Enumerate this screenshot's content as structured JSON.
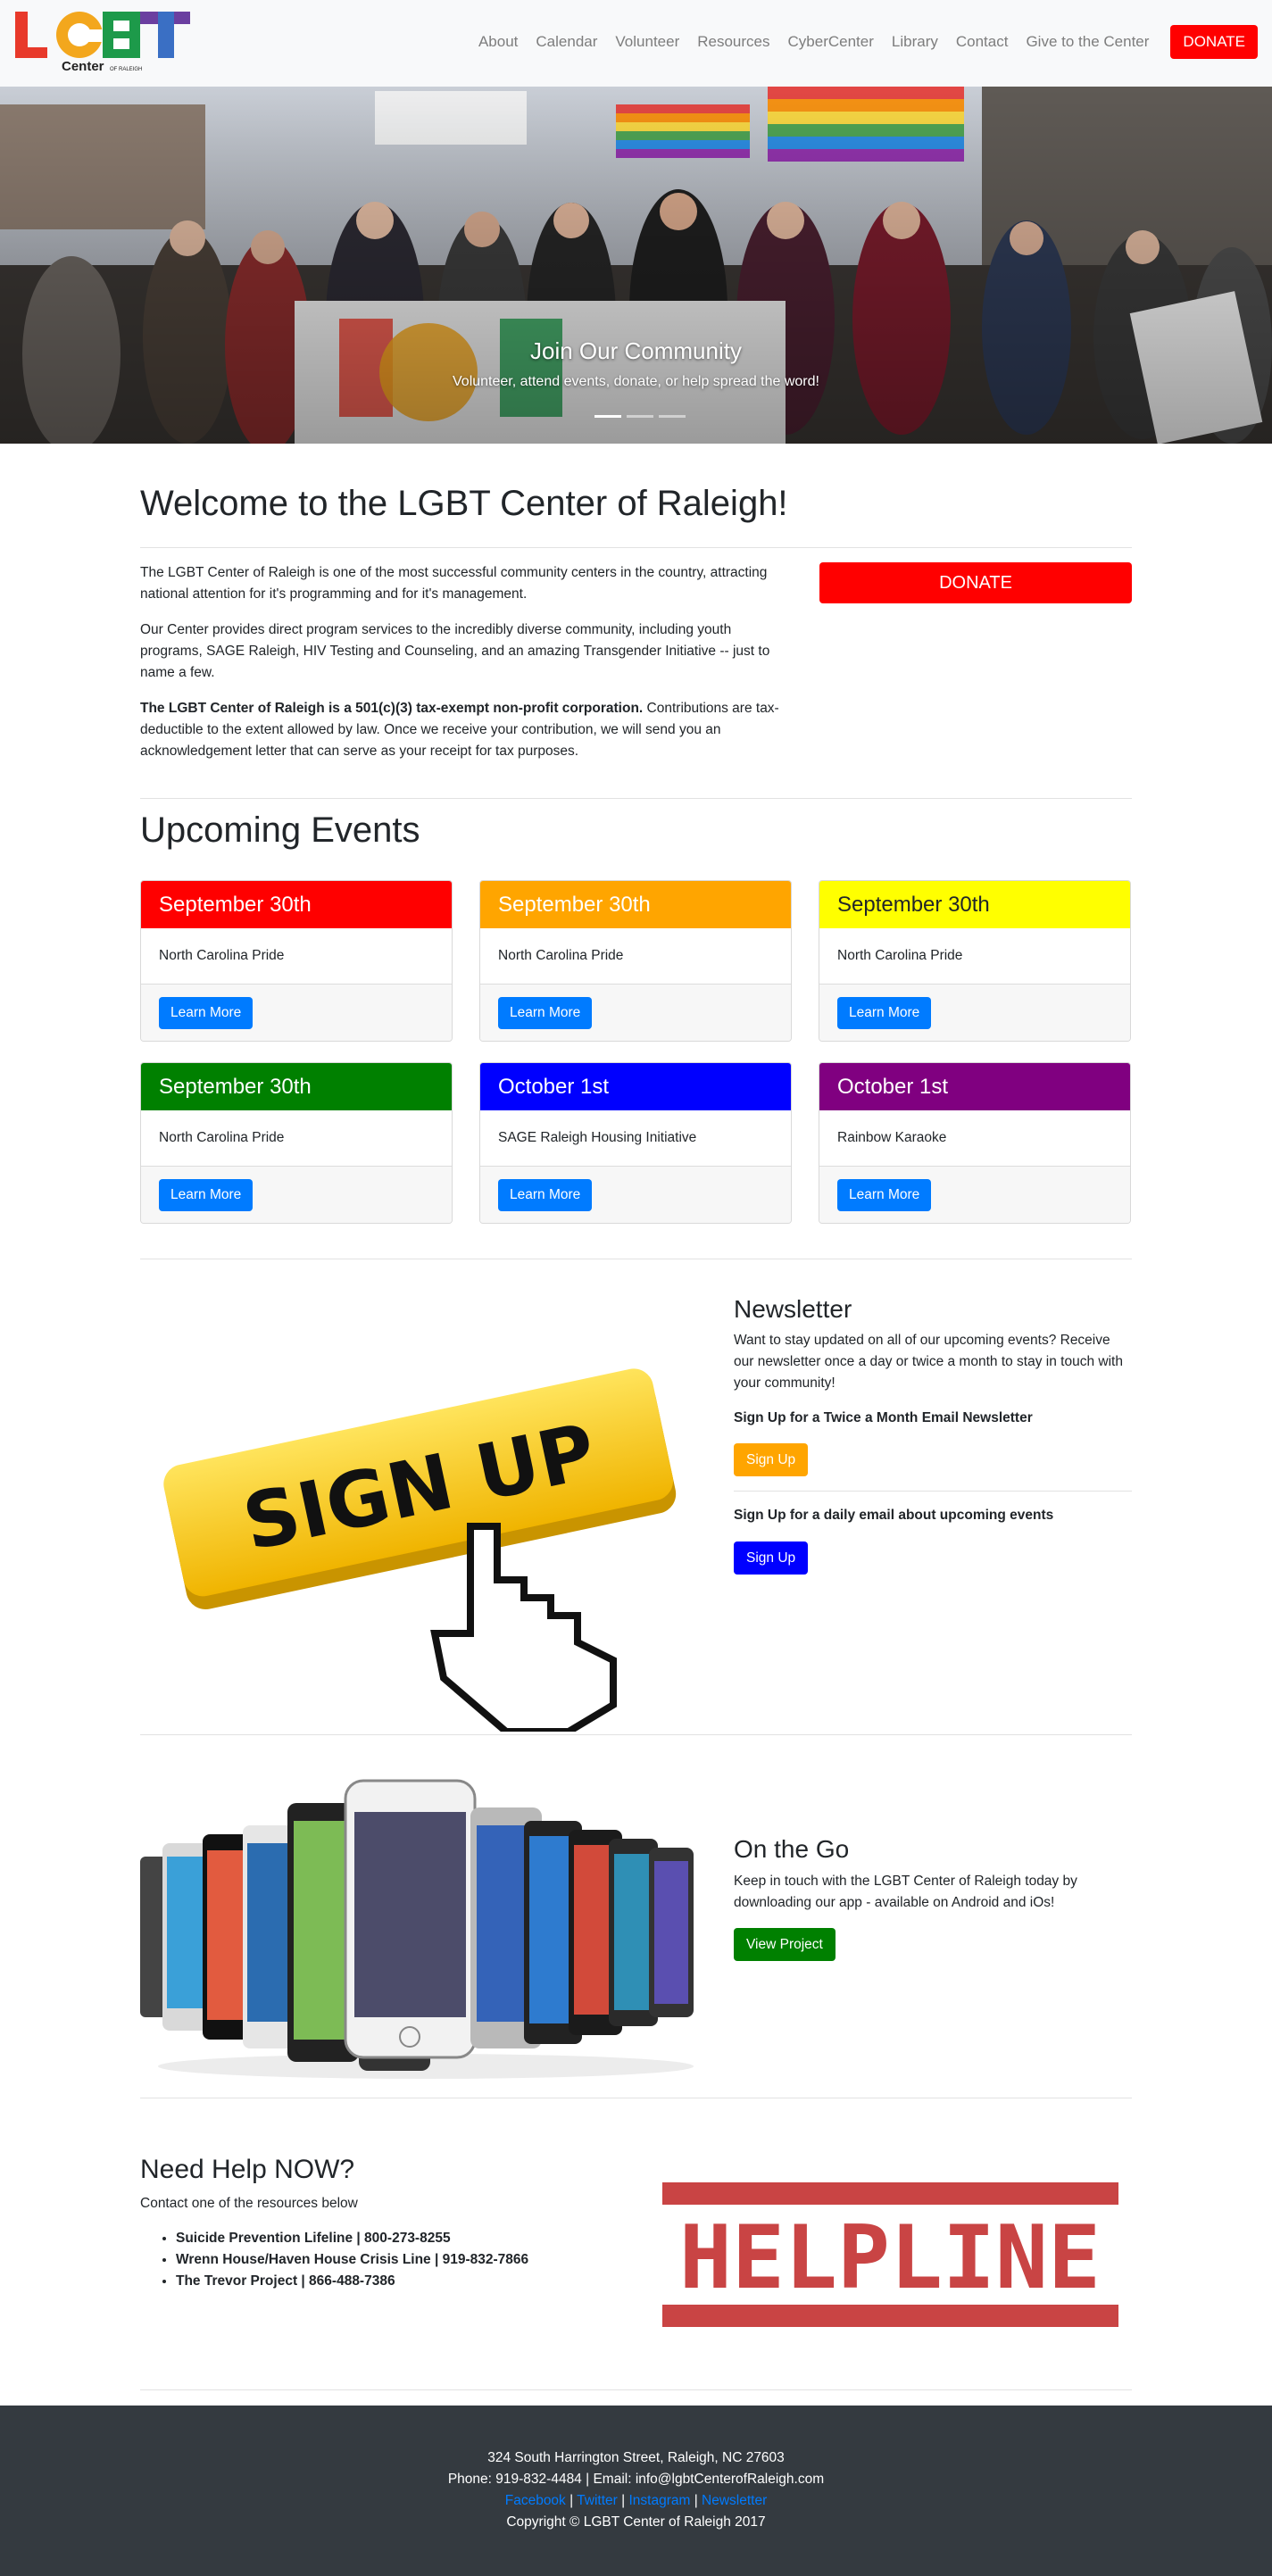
{
  "nav": {
    "logo_text": "LGBT",
    "logo_sub": "Center",
    "logo_small": "OF RALEIGH",
    "links": [
      "About",
      "Calendar",
      "Volunteer",
      "Resources",
      "CyberCenter",
      "Library",
      "Contact",
      "Give to the Center"
    ],
    "donate_label": "DONATE"
  },
  "hero": {
    "title": "Join Our Community",
    "subtitle": "Volunteer, attend events, donate, or help spread the word!"
  },
  "welcome": {
    "title": "Welcome to the LGBT Center of Raleigh!",
    "p1": "The LGBT Center of Raleigh is one of the most successful community centers in the country, attracting national attention for it's programming and for it's management.",
    "p2": "Our Center provides direct program services to the incredibly diverse community, including youth programs, SAGE Raleigh, HIV Testing and Counseling, and an amazing Transgender Initiative -- just to name a few.",
    "p3_bold": "The LGBT Center of Raleigh is a 501(c)(3) tax-exempt non-profit corporation.",
    "p3_rest": " Contributions are tax-deductible to the extent allowed by law. Once we receive your contribution, we will send you an acknowledgement letter that can serve as your receipt for tax purposes.",
    "donate_label": "DONATE"
  },
  "events": {
    "title": "Upcoming Events",
    "cards": [
      {
        "date": "September 30th",
        "name": "North Carolina Pride",
        "button": "Learn More",
        "color": "#ff0000",
        "text_color": "#ffffff"
      },
      {
        "date": "September 30th",
        "name": "North Carolina Pride",
        "button": "Learn More",
        "color": "#ffa500",
        "text_color": "#ffffff"
      },
      {
        "date": "September 30th",
        "name": "North Carolina Pride",
        "button": "Learn More",
        "color": "#ffff00",
        "text_color": "#212529"
      },
      {
        "date": "September 30th",
        "name": "North Carolina Pride",
        "button": "Learn More",
        "color": "#008000",
        "text_color": "#ffffff"
      },
      {
        "date": "October 1st",
        "name": "SAGE Raleigh Housing Initiative",
        "button": "Learn More",
        "color": "#0000ff",
        "text_color": "#ffffff"
      },
      {
        "date": "October 1st",
        "name": "Rainbow Karaoke",
        "button": "Learn More",
        "color": "#800080",
        "text_color": "#ffffff"
      }
    ]
  },
  "newsletter": {
    "image_text": "SIGN UP",
    "title": "Newsletter",
    "text": "Want to stay updated on all of our upcoming events? Receive our newsletter once a day or twice a month to stay in touch with your community!",
    "option1": "Sign Up for a Twice a Month Email Newsletter",
    "option1_button": "Sign Up",
    "option2": "Sign Up for a daily email about upcoming events",
    "option2_button": "Sign Up"
  },
  "onthego": {
    "title": "On the Go",
    "text": "Keep in touch with the LGBT Center of Raleigh today by downloading our app - available on Android and iOs!",
    "button": "View Project"
  },
  "help": {
    "title": "Need Help NOW?",
    "subtitle": "Contact one of the resources below",
    "items": [
      "Suicide Prevention Lifeline | 800-273-8255",
      "Wrenn House/Haven House Crisis Line | 919-832-7866",
      "The Trevor Project | 866-488-7386"
    ],
    "image_text": "HELPLINE"
  },
  "footer": {
    "address": "324 South Harrington Street, Raleigh, NC 27603",
    "contact": "Phone: 919-832-4484 | Email: info@lgbtCenterofRaleigh.com",
    "links": [
      "Facebook",
      "Twitter",
      "Instagram",
      "Newsletter"
    ],
    "sep": " | ",
    "copyright": "Copyright © LGBT Center of Raleigh 2017"
  }
}
